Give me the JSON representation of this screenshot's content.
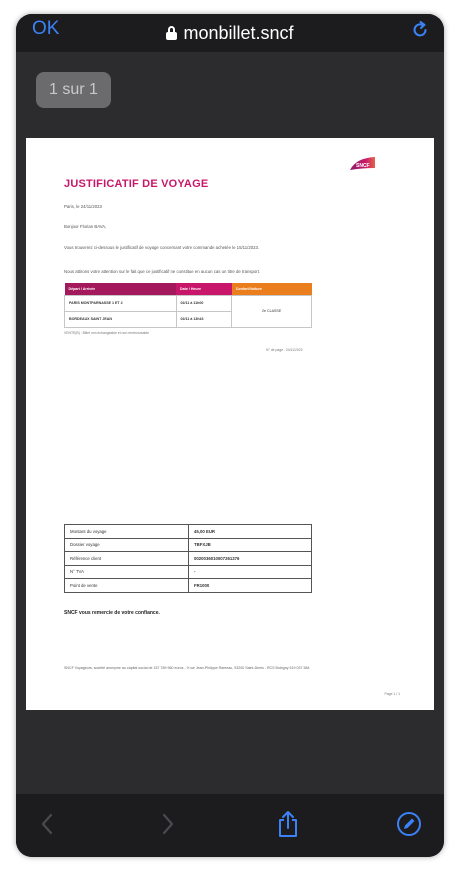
{
  "browser": {
    "ok_label": "OK",
    "url": "monbillet.sncf",
    "accent": "#3b82f6"
  },
  "viewer": {
    "page_count": "1 sur 1"
  },
  "document": {
    "logo_text": "SNCF",
    "title": "JUSTIFICATIF DE VOYAGE",
    "date_line": "Paris, le 24/11/2023",
    "greeting": "Bonjour Florian BAVA,",
    "paragraph1": "Vous trouverez ci-dessous le justificatif de voyage concernant votre commande achetée le 15/11/2023.",
    "paragraph2": "Nous attirons votre attention sur le fait que ce justificatif ne constitue en aucun cas un titre de transport.",
    "trip_headers": [
      "Départ / Arrivée",
      "Date / Heure",
      "Confort/Voiture"
    ],
    "trip_rows": [
      [
        "PARIS MONTPARNASSE 1 ET 2",
        "02/11 à 11h00"
      ],
      [
        "BORDEAUX SAINT JEAN",
        "02/11 à 13h16"
      ]
    ],
    "trip_comfort": "2e CLASSE",
    "legend": "VENTE(B) : Billet non échangeable et non remboursable",
    "page_ref": "N° de page : 24/11/2023",
    "info_rows": [
      [
        "Montant du voyage",
        "45,00 EUR"
      ],
      [
        "Dossier voyage",
        "TBFXJB"
      ],
      [
        "Référence client",
        "0020036010007261376"
      ],
      [
        "N° TVA",
        "-"
      ],
      [
        "Point de vente",
        "FR1000"
      ]
    ],
    "thanks": "SNCF vous remercie de votre confiance.",
    "footer": "SNCF Voyageurs, société anonyme au capital social de 157 789 960 euros - 9 rue Jean-Philippe Rameau, 93200 Saint-Denis - RCS Bobigny 519 037 584",
    "page_number": "Page 1 / 1",
    "colors": {
      "title": "#c8176a",
      "header_a": "#a3195b",
      "header_b": "#c8176a",
      "header_c": "#ea7d1c"
    }
  },
  "toolbar": {
    "back_icon": "chevron-left-icon",
    "forward_icon": "chevron-right-icon",
    "share_icon": "share-icon",
    "markup_icon": "markup-pen-icon"
  }
}
